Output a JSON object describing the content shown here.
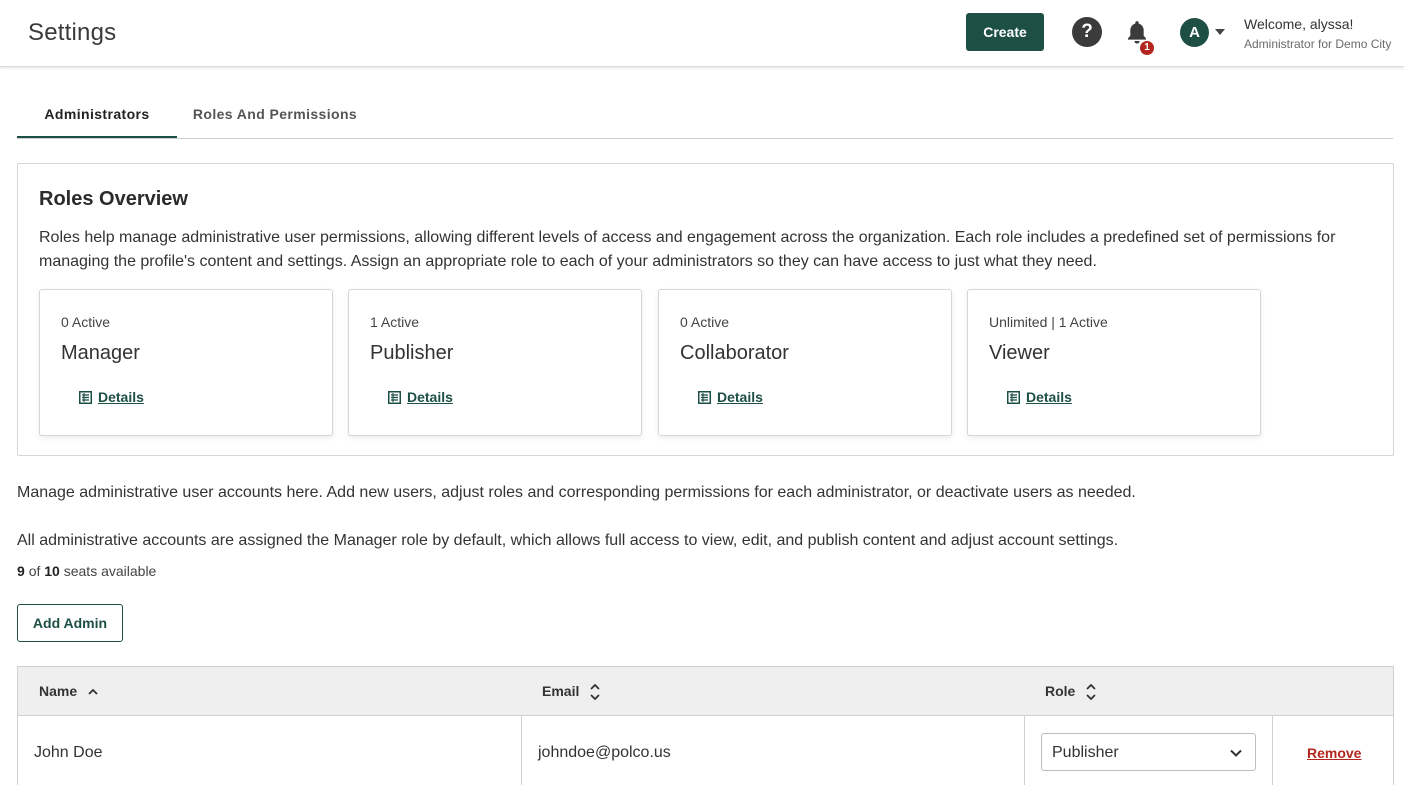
{
  "header": {
    "title": "Settings",
    "create_label": "Create",
    "help_glyph": "?",
    "notification_count": "1",
    "avatar_initial": "A",
    "welcome": "Welcome, alyssa!",
    "subtitle": "Administrator for Demo City"
  },
  "tabs": [
    {
      "label": "Administrators",
      "active": true
    },
    {
      "label": "Roles And Permissions",
      "active": false
    }
  ],
  "overview": {
    "title": "Roles Overview",
    "description": "Roles help manage administrative user permissions, allowing different levels of access and engagement across the organization. Each role includes a predefined set of permissions for managing the profile's content and settings. Assign an appropriate role to each of your administrators so they can have access to just what they need.",
    "roles": [
      {
        "active": "0 Active",
        "name": "Manager",
        "details": "Details"
      },
      {
        "active": "1 Active",
        "name": "Publisher",
        "details": "Details"
      },
      {
        "active": "0 Active",
        "name": "Collaborator",
        "details": "Details"
      },
      {
        "active": "Unlimited | 1 Active",
        "name": "Viewer",
        "details": "Details"
      }
    ]
  },
  "info": {
    "line1": "Manage administrative user accounts here. Add new users, adjust roles and corresponding permissions for each administrator, or deactivate users as needed.",
    "line2": "All administrative accounts are assigned the Manager role by default, which allows full access to view, edit, and publish content and adjust account settings.",
    "seats_available": "9",
    "seats_of": "of",
    "seats_total": "10",
    "seats_suffix": "seats available"
  },
  "add_admin_label": "Add Admin",
  "table": {
    "columns": [
      "Name",
      "Email",
      "Role"
    ],
    "rows": [
      {
        "name": "John Doe",
        "email": "johndoe@polco.us",
        "role": "Publisher",
        "action": "Remove"
      }
    ]
  },
  "colors": {
    "brand": "#1d4f45",
    "danger": "#b3261e"
  },
  "icons": [
    "help-icon",
    "bell-icon",
    "chevron-down-icon",
    "details-icon",
    "sort-asc-icon",
    "sort-icon"
  ]
}
